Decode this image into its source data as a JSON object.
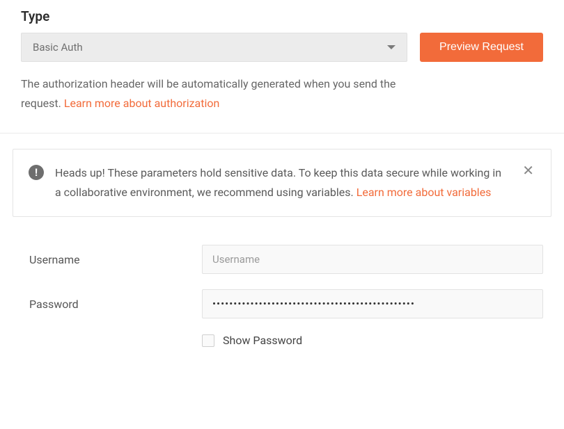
{
  "title": "Type",
  "auth": {
    "selected": "Basic Auth",
    "preview_button_label": "Preview Request"
  },
  "description": {
    "text": "The authorization header will be automatically generated when you send the request. ",
    "link_text": "Learn more about authorization"
  },
  "warning": {
    "prefix": "Heads up!",
    "text": " These parameters hold sensitive data. To keep this data secure while working in a collaborative environment, we recommend using variables. ",
    "link_text": "Learn more about variables"
  },
  "form": {
    "username": {
      "label": "Username",
      "placeholder": "Username",
      "value": ""
    },
    "password": {
      "label": "Password",
      "value": "••••••••••••••••••••••••••••••••••••••••••••••••"
    },
    "show_password_label": "Show Password"
  }
}
